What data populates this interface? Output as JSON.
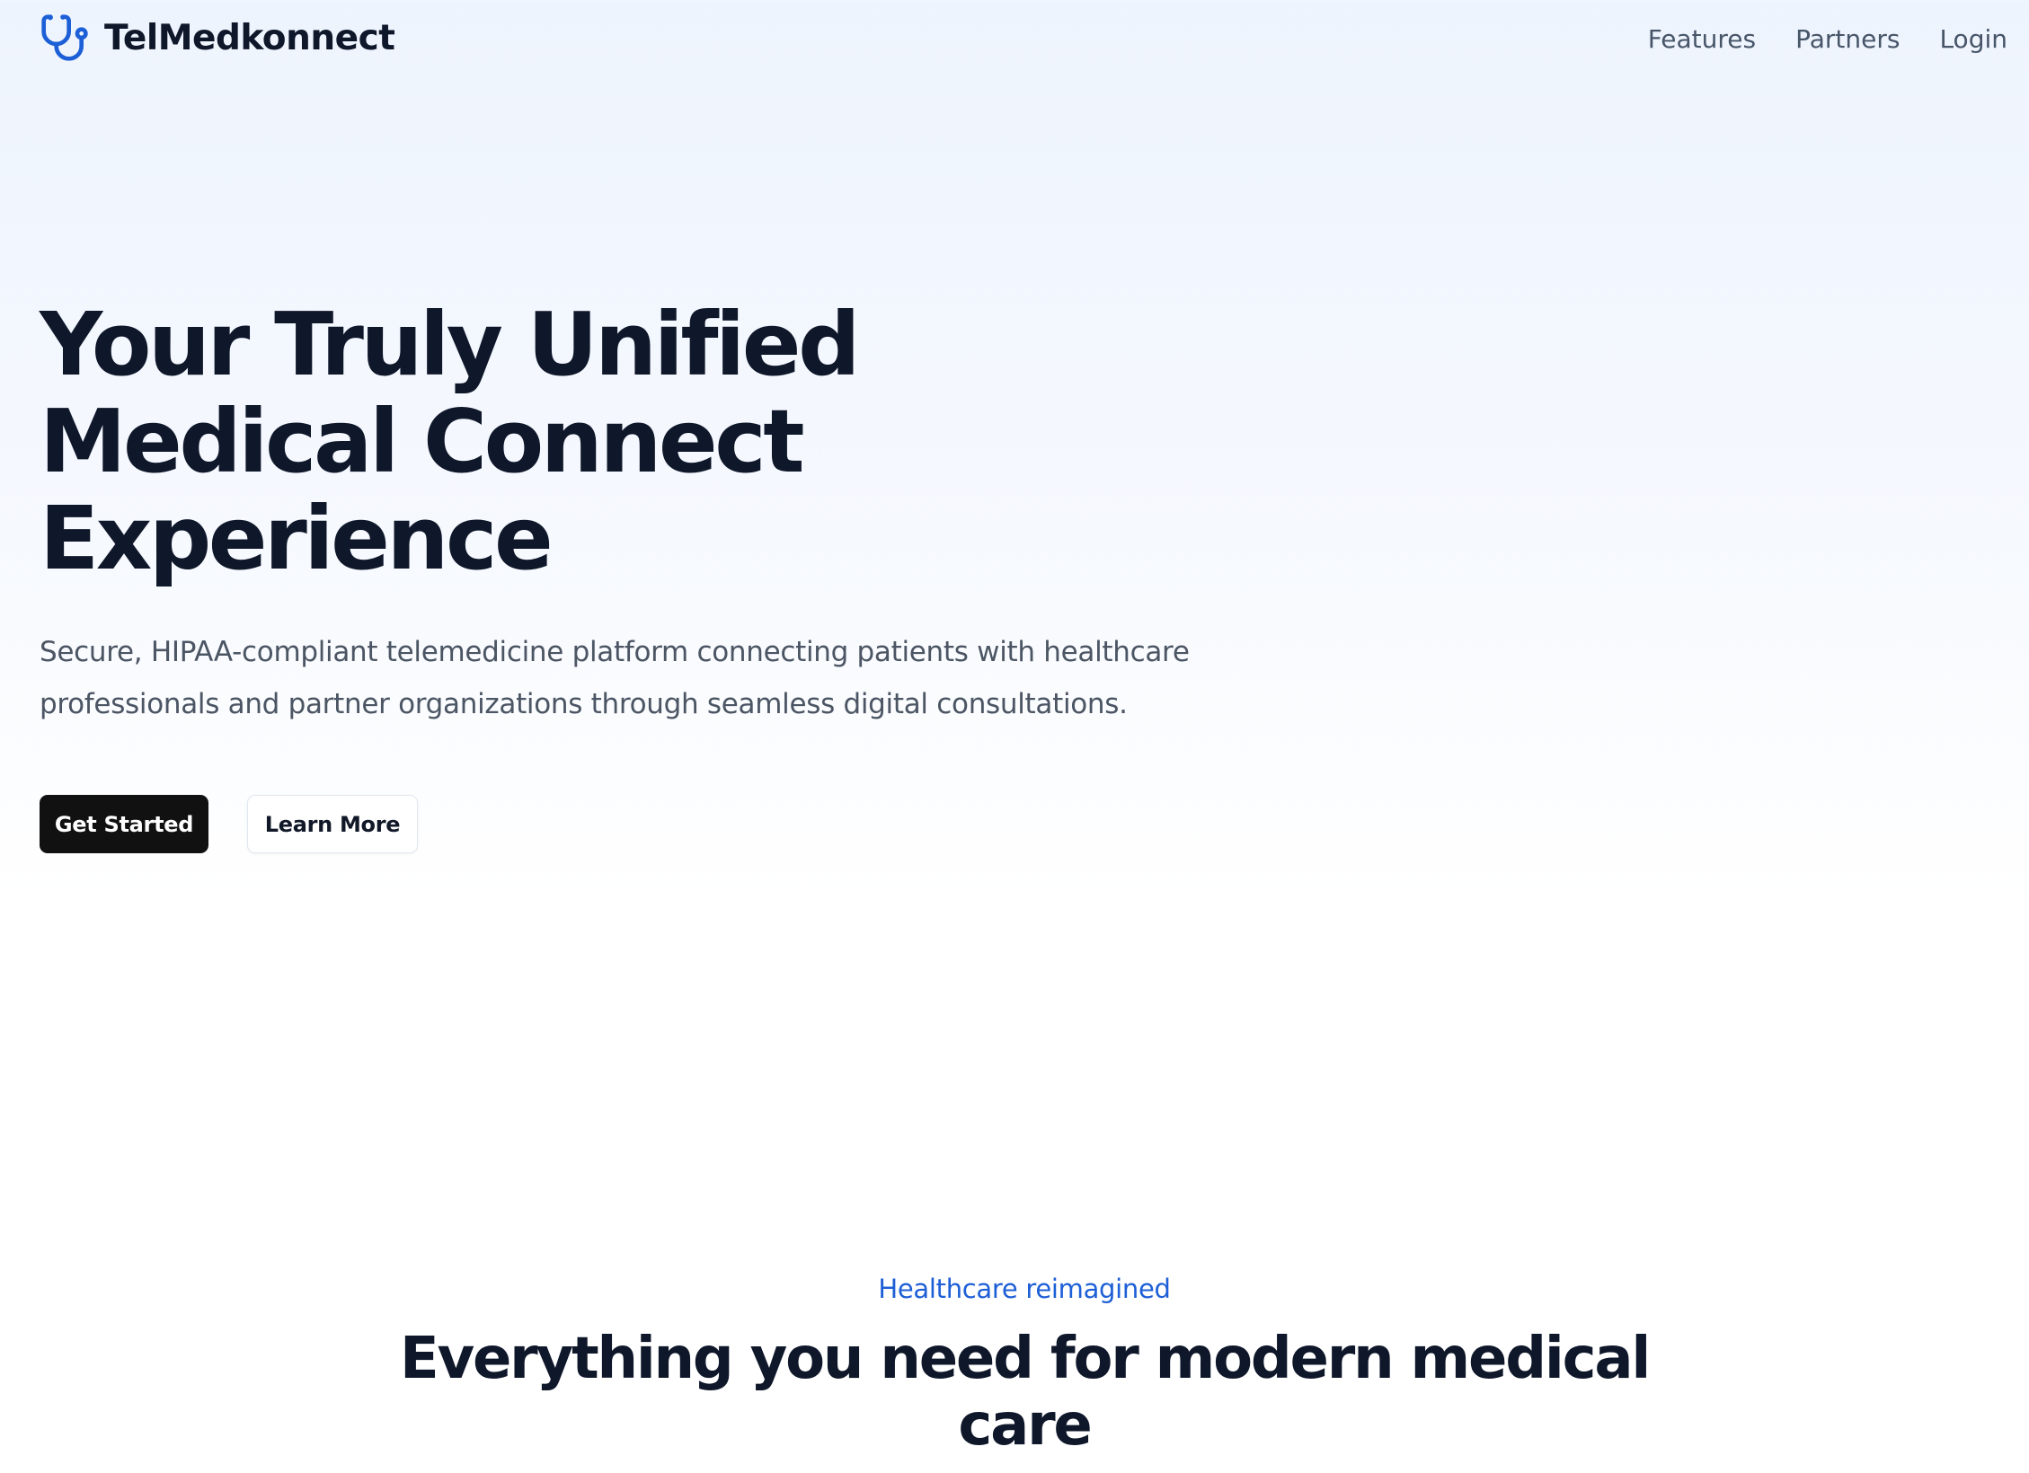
{
  "header": {
    "brand_name": "TelMedkonnect",
    "brand_icon": "stethoscope-icon",
    "brand_color": "#1d5fd6",
    "nav": {
      "features": "Features",
      "partners": "Partners",
      "login": "Login"
    }
  },
  "hero": {
    "title_lines": [
      "Your Truly Unified",
      "Medical Connect",
      "Experience"
    ],
    "subtitle_lines": [
      "Secure, HIPAA-compliant telemedicine platform connecting patients with healthcare",
      "professionals and partner organizations through seamless digital consultations."
    ],
    "primary_button": "Get Started",
    "secondary_button": "Learn More"
  },
  "features_section": {
    "eyebrow": "Healthcare reimagined",
    "title_lines": [
      "Everything you need for modern medical",
      "care"
    ]
  },
  "colors": {
    "accent": "#1d5fd6",
    "primary_button_bg": "#111111",
    "heading_text": "#0f172a",
    "body_text": "#4b5563"
  }
}
